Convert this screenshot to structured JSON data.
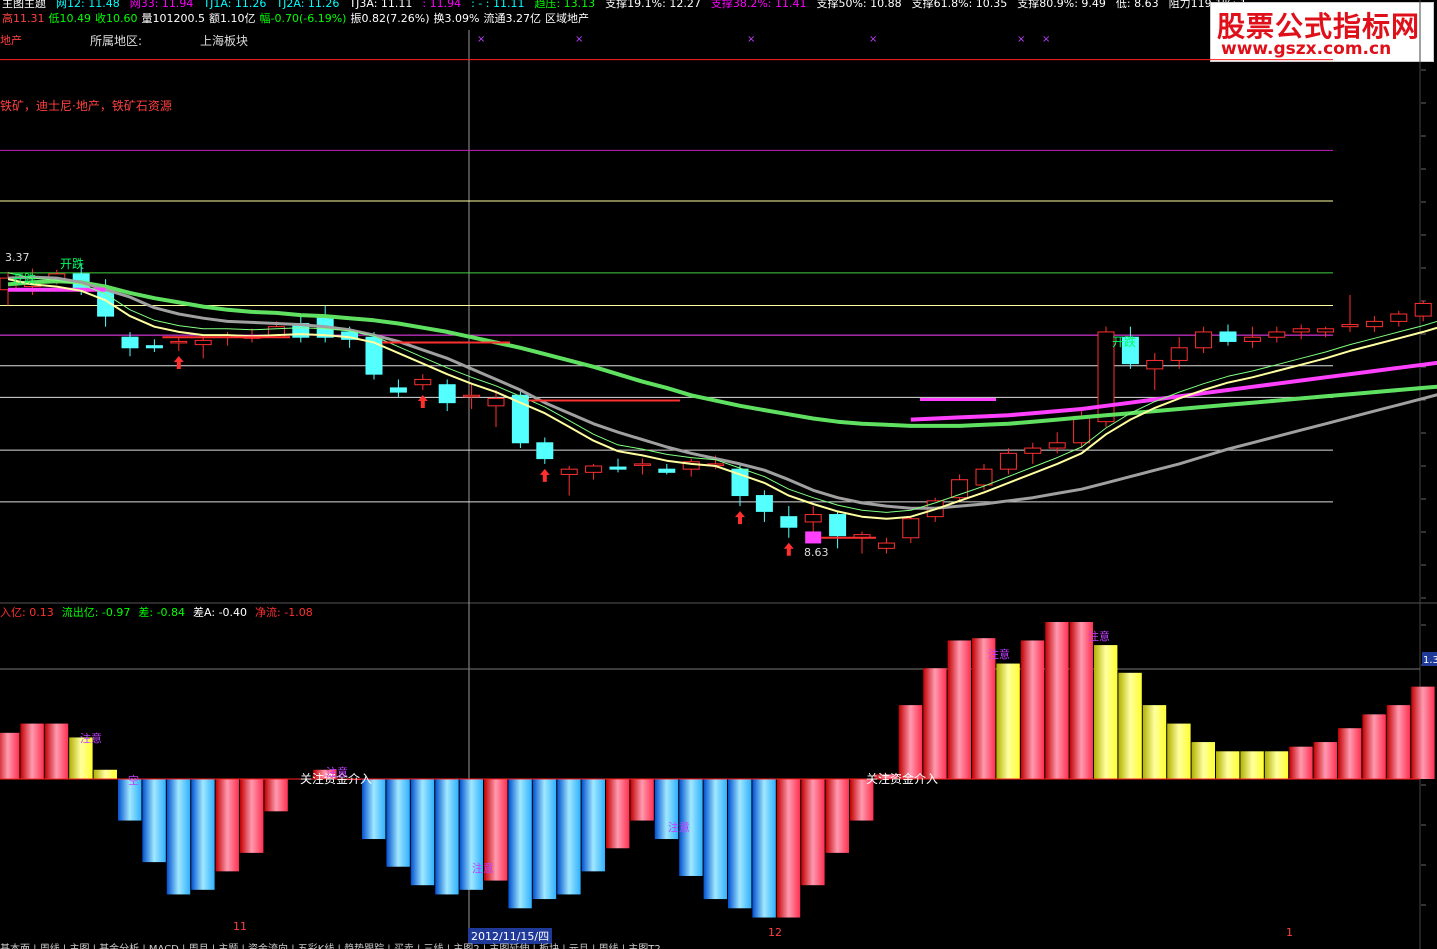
{
  "top_info": {
    "row1": [
      {
        "text": "主图主题",
        "color": "#ffffff"
      },
      {
        "text": "网12: 11.48",
        "color": "#00ffff"
      },
      {
        "text": "网33: 11.94",
        "color": "#ff00ff"
      },
      {
        "text": "TJ1A: 11.26",
        "color": "#00ffff"
      },
      {
        "text": "TJ2A: 11.26",
        "color": "#00ffff"
      },
      {
        "text": "TJ3A: 11.11",
        "color": "#ffffff"
      },
      {
        "text": ": 11.94",
        "color": "#ff00ff"
      },
      {
        "text": ": - : 11.11",
        "color": "#00ffff"
      },
      {
        "text": "趋压: 13.13",
        "color": "#00ff00"
      },
      {
        "text": "支撑19.1%: 12.27",
        "color": "#ffffff"
      },
      {
        "text": "支撑38.2%: 11.41",
        "color": "#ff00ff"
      },
      {
        "text": "支撑50%: 10.88",
        "color": "#ffffff"
      },
      {
        "text": "支撑61.8%: 10.35",
        "color": "#ffffff"
      },
      {
        "text": "支撑80.9%: 9.49",
        "color": "#ffffff"
      },
      {
        "text": "低: 8.63",
        "color": "#ffffff"
      },
      {
        "text": "阻力119.1%: 1",
        "color": "#ffffff"
      }
    ],
    "row2": [
      {
        "text": "高11.31",
        "color": "#ff4040"
      },
      {
        "text": "低10.49",
        "color": "#00ff00"
      },
      {
        "text": "收10.60",
        "color": "#00ff00"
      },
      {
        "text": "量101200.5",
        "color": "#ffffff"
      },
      {
        "text": "额1.10亿",
        "color": "#ffffff"
      },
      {
        "text": "幅-0.70(-6.19%)",
        "color": "#00ff00"
      },
      {
        "text": "振0.82(7.26%)",
        "color": "#ffffff"
      },
      {
        "text": "换3.09%",
        "color": "#ffffff"
      },
      {
        "text": "流通3.27亿",
        "color": "#ffffff"
      },
      {
        "text": "区域地产",
        "color": "#ffffff"
      }
    ],
    "row3_left": "地产",
    "region_label": "所属地区:",
    "region_value": "上海板块",
    "concept_text": "铁矿，迪士尼·地产，铁矿石资源"
  },
  "watermark": {
    "title": "股票公式指标网",
    "url": "www.gszx.com.cn"
  },
  "upper_labels": {
    "price_label_top": "3.37",
    "kaidie_1": "开跌",
    "kaidie_2": "开跌",
    "kaidie_3": "开跌",
    "low_label": "8.63"
  },
  "lower_info": [
    {
      "text": "入亿: 0.13",
      "color": "#ff3030"
    },
    {
      "text": "流出亿: -0.97",
      "color": "#00ff00"
    },
    {
      "text": "差: -0.84",
      "color": "#00ff00"
    },
    {
      "text": "差A: -0.40",
      "color": "#ffffff"
    },
    {
      "text": "净流: -1.08",
      "color": "#ff3030"
    }
  ],
  "lower_labels": {
    "zhuyi": "注意",
    "kong": "空",
    "zhuli": "关注资金介入",
    "right_axis": "1.3"
  },
  "x_labels": {
    "m11": "11",
    "m12": "12",
    "m1": "1",
    "cursor_date": "2012/11/15/四"
  },
  "bottom_tabs": "基本面 | 周线 | 主图 | 基金分析 | MACD | 周月 | 主题 | 资金流向 | 五彩K线 | 趋势跟踪 | 买卖 | 三线 | 主图2 | 主图延伸 | 板块 | 元旦 | 周线 | 主图T2",
  "colors": {
    "up": "#ff3030",
    "down": "#54ffff",
    "ma_white": "#ffffa0",
    "ma_gray": "#a0a0a0",
    "ma_green": "#60e060",
    "ma_magenta": "#ff40ff"
  },
  "chart_data": [
    {
      "type": "candlestick",
      "title": "",
      "ylim": [
        8.2,
        13.6
      ],
      "reference_lines": {
        "red": 13.13,
        "magenta_top": 12.27,
        "yellow": 11.79,
        "green": 11.11,
        "yellow_mid": 10.8,
        "magenta": 10.52,
        "white_1": 10.23,
        "white_2": 9.93,
        "white_3": 9.43,
        "white_4": 8.94
      },
      "candles": [
        {
          "o": 10.95,
          "h": 11.12,
          "l": 10.8,
          "c": 11.06
        },
        {
          "o": 10.98,
          "h": 11.15,
          "l": 10.9,
          "c": 11.0
        },
        {
          "o": 11.03,
          "h": 11.14,
          "l": 11.0,
          "c": 11.1
        },
        {
          "o": 11.1,
          "h": 11.2,
          "l": 10.9,
          "c": 10.95
        },
        {
          "o": 10.95,
          "h": 11.05,
          "l": 10.6,
          "c": 10.7
        },
        {
          "o": 10.5,
          "h": 10.55,
          "l": 10.32,
          "c": 10.4
        },
        {
          "o": 10.42,
          "h": 10.48,
          "l": 10.36,
          "c": 10.4
        },
        {
          "o": 10.45,
          "h": 10.5,
          "l": 10.37,
          "c": 10.46
        },
        {
          "o": 10.43,
          "h": 10.5,
          "l": 10.3,
          "c": 10.47
        },
        {
          "o": 10.5,
          "h": 10.55,
          "l": 10.42,
          "c": 10.52
        },
        {
          "o": 10.49,
          "h": 10.58,
          "l": 10.45,
          "c": 10.51
        },
        {
          "o": 10.5,
          "h": 10.65,
          "l": 10.5,
          "c": 10.6
        },
        {
          "o": 10.63,
          "h": 10.7,
          "l": 10.45,
          "c": 10.5
        },
        {
          "o": 10.7,
          "h": 10.8,
          "l": 10.45,
          "c": 10.5
        },
        {
          "o": 10.55,
          "h": 10.6,
          "l": 10.4,
          "c": 10.48
        },
        {
          "o": 10.5,
          "h": 10.55,
          "l": 10.1,
          "c": 10.15
        },
        {
          "o": 10.02,
          "h": 10.1,
          "l": 9.93,
          "c": 9.98
        },
        {
          "o": 10.05,
          "h": 10.15,
          "l": 10.0,
          "c": 10.1
        },
        {
          "o": 10.05,
          "h": 10.1,
          "l": 9.8,
          "c": 9.88
        },
        {
          "o": 9.95,
          "h": 10.05,
          "l": 9.82,
          "c": 9.95
        },
        {
          "o": 9.85,
          "h": 10.0,
          "l": 9.65,
          "c": 9.92
        },
        {
          "o": 9.95,
          "h": 10.0,
          "l": 9.45,
          "c": 9.5
        },
        {
          "o": 9.5,
          "h": 9.55,
          "l": 9.3,
          "c": 9.35
        },
        {
          "o": 9.2,
          "h": 9.28,
          "l": 9.0,
          "c": 9.25
        },
        {
          "o": 9.22,
          "h": 9.3,
          "l": 9.15,
          "c": 9.28
        },
        {
          "o": 9.27,
          "h": 9.35,
          "l": 9.22,
          "c": 9.25
        },
        {
          "o": 9.3,
          "h": 9.35,
          "l": 9.2,
          "c": 9.3
        },
        {
          "o": 9.25,
          "h": 9.3,
          "l": 9.2,
          "c": 9.22
        },
        {
          "o": 9.25,
          "h": 9.35,
          "l": 9.18,
          "c": 9.32
        },
        {
          "o": 9.3,
          "h": 9.38,
          "l": 9.25,
          "c": 9.3
        },
        {
          "o": 9.25,
          "h": 9.3,
          "l": 8.9,
          "c": 9.0
        },
        {
          "o": 9.0,
          "h": 9.05,
          "l": 8.75,
          "c": 8.85
        },
        {
          "o": 8.8,
          "h": 8.9,
          "l": 8.6,
          "c": 8.7
        },
        {
          "o": 8.75,
          "h": 8.9,
          "l": 8.6,
          "c": 8.82
        },
        {
          "o": 8.82,
          "h": 8.85,
          "l": 8.5,
          "c": 8.62
        },
        {
          "o": 8.6,
          "h": 8.66,
          "l": 8.45,
          "c": 8.63
        },
        {
          "o": 8.5,
          "h": 8.6,
          "l": 8.45,
          "c": 8.55
        },
        {
          "o": 8.6,
          "h": 8.8,
          "l": 8.55,
          "c": 8.78
        },
        {
          "o": 8.8,
          "h": 8.98,
          "l": 8.75,
          "c": 8.95
        },
        {
          "o": 8.98,
          "h": 9.2,
          "l": 8.95,
          "c": 9.15
        },
        {
          "o": 9.1,
          "h": 9.3,
          "l": 9.05,
          "c": 9.25
        },
        {
          "o": 9.25,
          "h": 9.45,
          "l": 9.2,
          "c": 9.4
        },
        {
          "o": 9.4,
          "h": 9.5,
          "l": 9.3,
          "c": 9.45
        },
        {
          "o": 9.45,
          "h": 9.6,
          "l": 9.4,
          "c": 9.5
        },
        {
          "o": 9.5,
          "h": 9.8,
          "l": 9.45,
          "c": 9.75
        },
        {
          "o": 9.7,
          "h": 10.6,
          "l": 9.65,
          "c": 10.55
        },
        {
          "o": 10.5,
          "h": 10.6,
          "l": 10.2,
          "c": 10.25
        },
        {
          "o": 10.2,
          "h": 10.35,
          "l": 10.0,
          "c": 10.28
        },
        {
          "o": 10.28,
          "h": 10.5,
          "l": 10.2,
          "c": 10.4
        },
        {
          "o": 10.4,
          "h": 10.6,
          "l": 10.35,
          "c": 10.55
        },
        {
          "o": 10.55,
          "h": 10.62,
          "l": 10.42,
          "c": 10.46
        },
        {
          "o": 10.46,
          "h": 10.6,
          "l": 10.4,
          "c": 10.5
        },
        {
          "o": 10.5,
          "h": 10.6,
          "l": 10.45,
          "c": 10.55
        },
        {
          "o": 10.55,
          "h": 10.62,
          "l": 10.48,
          "c": 10.58
        },
        {
          "o": 10.55,
          "h": 10.6,
          "l": 10.5,
          "c": 10.58
        },
        {
          "o": 10.6,
          "h": 10.9,
          "l": 10.55,
          "c": 10.62
        },
        {
          "o": 10.6,
          "h": 10.7,
          "l": 10.55,
          "c": 10.65
        },
        {
          "o": 10.65,
          "h": 10.75,
          "l": 10.6,
          "c": 10.72
        },
        {
          "o": 10.7,
          "h": 10.85,
          "l": 10.65,
          "c": 10.82
        },
        {
          "o": 10.85,
          "h": 11.05,
          "l": 10.78,
          "c": 10.98
        },
        {
          "o": 11.0,
          "h": 11.1,
          "l": 10.9,
          "c": 10.92
        },
        {
          "o": 10.9,
          "h": 11.2,
          "l": 10.88,
          "c": 11.18
        }
      ],
      "ma_white": [
        11.05,
        11.0,
        10.98,
        10.94,
        10.85,
        10.7,
        10.6,
        10.55,
        10.52,
        10.52,
        10.51,
        10.52,
        10.53,
        10.52,
        10.5,
        10.45,
        10.35,
        10.25,
        10.15,
        10.06,
        9.98,
        9.88,
        9.78,
        9.65,
        9.52,
        9.42,
        9.38,
        9.33,
        9.3,
        9.28,
        9.2,
        9.12,
        9.0,
        8.92,
        8.85,
        8.8,
        8.78,
        8.8,
        8.87,
        8.95,
        9.03,
        9.12,
        9.21,
        9.3,
        9.4,
        9.58,
        9.72,
        9.83,
        9.92,
        10.0,
        10.07,
        10.12,
        10.18,
        10.24,
        10.3,
        10.37,
        10.43,
        10.49,
        10.55,
        10.62,
        10.7,
        10.78
      ],
      "ma_gray": [
        11.06,
        11.07,
        11.06,
        11.02,
        10.95,
        10.88,
        10.78,
        10.72,
        10.68,
        10.65,
        10.64,
        10.63,
        10.62,
        10.6,
        10.57,
        10.52,
        10.46,
        10.38,
        10.3,
        10.2,
        10.1,
        10.0,
        9.88,
        9.78,
        9.68,
        9.6,
        9.53,
        9.46,
        9.4,
        9.35,
        9.3,
        9.24,
        9.15,
        9.05,
        8.98,
        8.93,
        8.9,
        8.88,
        8.88,
        8.9,
        8.92,
        8.95,
        8.98,
        9.02,
        9.06,
        9.12,
        9.18,
        9.24,
        9.3,
        9.37,
        9.44,
        9.5,
        9.56,
        9.62,
        9.68,
        9.74,
        9.8,
        9.86,
        9.92,
        9.98,
        10.04,
        10.1
      ],
      "ma_green": [
        11.0,
        11.02,
        11.03,
        11.02,
        10.98,
        10.92,
        10.87,
        10.83,
        10.79,
        10.76,
        10.74,
        10.73,
        10.71,
        10.7,
        10.68,
        10.66,
        10.63,
        10.59,
        10.55,
        10.5,
        10.45,
        10.4,
        10.34,
        10.28,
        10.22,
        10.15,
        10.08,
        10.02,
        9.95,
        9.9,
        9.85,
        9.81,
        9.77,
        9.73,
        9.7,
        9.68,
        9.67,
        9.66,
        9.66,
        9.66,
        9.67,
        9.68,
        9.7,
        9.72,
        9.74,
        9.76,
        9.78,
        9.8,
        9.82,
        9.84,
        9.86,
        9.88,
        9.9,
        9.92,
        9.94,
        9.96,
        9.98,
        10.0,
        10.02,
        10.04,
        10.06,
        10.08
      ],
      "ma_magenta": [
        10.95,
        10.95,
        10.95,
        10.95,
        10.95,
        null,
        null,
        null,
        null,
        null,
        null,
        null,
        null,
        null,
        null,
        null,
        null,
        null,
        null,
        null,
        null,
        null,
        null,
        null,
        null,
        null,
        null,
        null,
        null,
        null,
        null,
        null,
        null,
        null,
        null,
        null,
        null,
        9.72,
        9.73,
        9.74,
        9.75,
        9.76,
        9.78,
        9.8,
        9.82,
        9.85,
        9.88,
        9.91,
        9.94,
        9.97,
        10.0,
        10.03,
        10.06,
        10.09,
        10.12,
        10.15,
        10.18,
        10.21,
        10.24,
        10.27,
        10.3,
        10.33
      ]
    },
    {
      "type": "bar",
      "title": "",
      "ylim": [
        -3.1,
        3.4
      ],
      "values": [
        1.0,
        1.2,
        1.2,
        0.9,
        0.2,
        -0.9,
        -1.8,
        -2.5,
        -2.4,
        -2.0,
        -1.6,
        -0.7,
        0.01,
        0.2,
        0.0,
        -1.3,
        -1.9,
        -2.3,
        -2.5,
        -2.4,
        -2.2,
        -2.8,
        -2.6,
        -2.5,
        -2.0,
        -1.5,
        -0.9,
        -1.3,
        -2.1,
        -2.6,
        -2.8,
        -3.0,
        -3.0,
        -2.3,
        -1.6,
        -0.9,
        0.1,
        1.6,
        2.4,
        3.0,
        3.05,
        2.5,
        3.0,
        3.4,
        3.4,
        2.9,
        2.3,
        1.6,
        1.2,
        0.8,
        0.6,
        0.6,
        0.6,
        0.7,
        0.8,
        1.1,
        1.4,
        1.6,
        2.0
      ],
      "colors": [
        "r",
        "r",
        "r",
        "y",
        "y",
        "b",
        "b",
        "b",
        "b",
        "r",
        "r",
        "r",
        "r",
        "r",
        "r",
        "b",
        "b",
        "b",
        "b",
        "b",
        "r",
        "b",
        "b",
        "b",
        "b",
        "r",
        "r",
        "b",
        "b",
        "b",
        "b",
        "b",
        "r",
        "r",
        "r",
        "r",
        "r",
        "r",
        "r",
        "r",
        "r",
        "y",
        "r",
        "r",
        "r",
        "y",
        "y",
        "y",
        "y",
        "y",
        "y",
        "y",
        "y",
        "r",
        "r",
        "r",
        "r",
        "r",
        "r"
      ]
    }
  ]
}
